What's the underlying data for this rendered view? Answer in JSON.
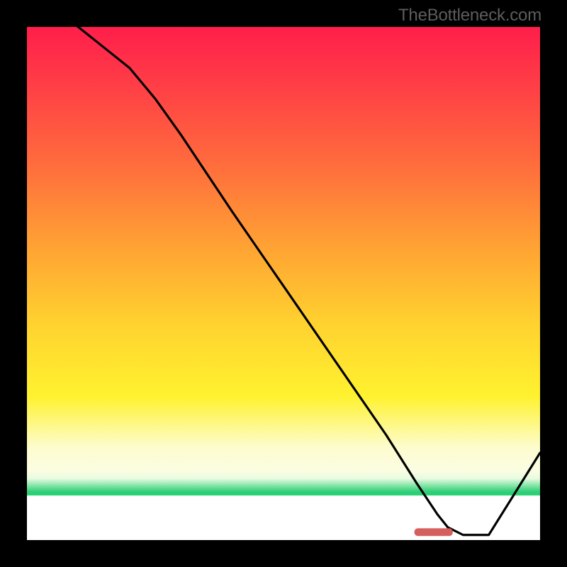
{
  "watermark": "TheBottleneck.com",
  "chart_data": {
    "type": "line",
    "title": "",
    "xlabel": "",
    "ylabel": "",
    "axes_visible": false,
    "xlim": [
      0,
      100
    ],
    "ylim": [
      0,
      100
    ],
    "series": [
      {
        "name": "bottleneck-curve",
        "x": [
          0,
          5,
          10,
          15,
          20,
          25,
          30,
          40,
          50,
          60,
          70,
          76,
          80,
          82,
          85,
          90,
          95,
          100
        ],
        "values": [
          108,
          104,
          100,
          96,
          92,
          86,
          79,
          64,
          49.5,
          35,
          20.5,
          11,
          5,
          2.5,
          1,
          1,
          9,
          17
        ]
      }
    ],
    "annotations": [
      {
        "name": "optimal-bar",
        "shape": "rect",
        "x0": 75.5,
        "x1": 83,
        "y0": 0.8,
        "y1": 2.3,
        "fill": "#d45f5c"
      }
    ],
    "gradient_bands_pct_from_top": {
      "red": 0,
      "orange": 38,
      "yellow": 62,
      "pale": 82,
      "green": 89,
      "white": 91.3
    }
  }
}
